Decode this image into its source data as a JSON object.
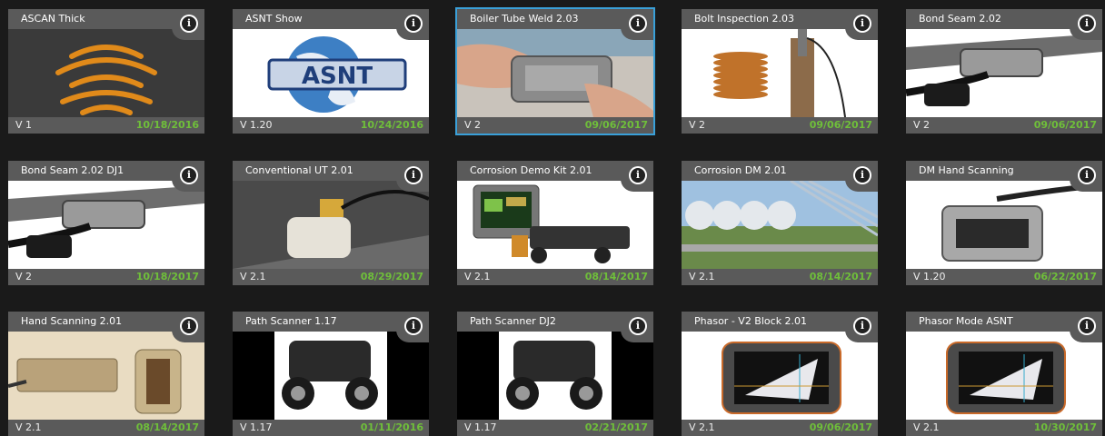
{
  "colors": {
    "background": "#1a1a1a",
    "tile_bar": "#5a5a5a",
    "date_green": "#6fbf3a",
    "selected_border": "#3aa0d8"
  },
  "tiles": [
    {
      "title": "ASCAN Thick",
      "version": "V 1",
      "date": "10/18/2016",
      "thumb": "ascan-waves"
    },
    {
      "title": "ASNT Show",
      "version": "V 1.20",
      "date": "10/24/2016",
      "thumb": "asnt-logo"
    },
    {
      "title": "Boiler Tube Weld 2.03",
      "version": "V 2",
      "date": "09/06/2017",
      "thumb": "hand-scanner",
      "selected": true
    },
    {
      "title": "Bolt Inspection 2.03",
      "version": "V 2",
      "date": "09/06/2017",
      "thumb": "bolt"
    },
    {
      "title": "Bond Seam 2.02",
      "version": "V 2",
      "date": "09/06/2017",
      "thumb": "bond-seam"
    },
    {
      "title": "Bond Seam 2.02 DJ1",
      "version": "V 2",
      "date": "10/18/2017",
      "thumb": "bond-seam"
    },
    {
      "title": "Conventional UT 2.01",
      "version": "V 2.1",
      "date": "08/29/2017",
      "thumb": "probe-plate"
    },
    {
      "title": "Corrosion Demo Kit 2.01",
      "version": "V 2.1",
      "date": "08/14/2017",
      "thumb": "demo-kit"
    },
    {
      "title": "Corrosion DM 2.01",
      "version": "V 2.1",
      "date": "08/14/2017",
      "thumb": "tanks"
    },
    {
      "title": "DM Hand Scanning",
      "version": "V 1.20",
      "date": "06/22/2017",
      "thumb": "hand-probe"
    },
    {
      "title": "Hand Scanning 2.01",
      "version": "V 2.1",
      "date": "08/14/2017",
      "thumb": "gold-probes"
    },
    {
      "title": "Path Scanner 1.17",
      "version": "V 1.17",
      "date": "01/11/2016",
      "thumb": "path-scanner"
    },
    {
      "title": "Path Scanner DJ2",
      "version": "V 1.17",
      "date": "02/21/2017",
      "thumb": "path-scanner"
    },
    {
      "title": "Phasor - V2 Block 2.01",
      "version": "V 2.1",
      "date": "09/06/2017",
      "thumb": "phasor"
    },
    {
      "title": "Phasor Mode ASNT",
      "version": "V 2.1",
      "date": "10/30/2017",
      "thumb": "phasor"
    }
  ]
}
